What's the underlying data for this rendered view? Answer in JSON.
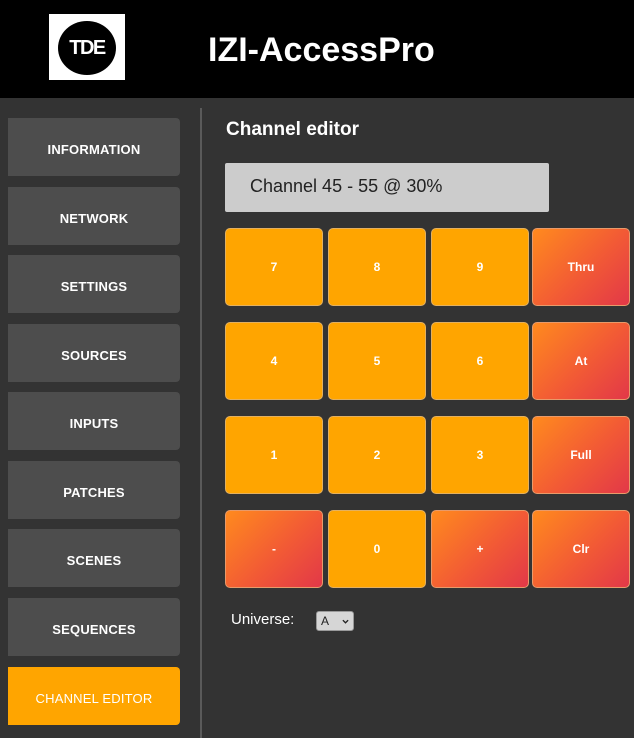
{
  "header": {
    "logo_text": "TDE",
    "app_title": "IZI-AccessPro"
  },
  "sidebar": {
    "items": [
      {
        "label": "INFORMATION"
      },
      {
        "label": "NETWORK"
      },
      {
        "label": "SETTINGS"
      },
      {
        "label": "SOURCES"
      },
      {
        "label": "INPUTS"
      },
      {
        "label": "PATCHES"
      },
      {
        "label": "SCENES"
      },
      {
        "label": "SEQUENCES"
      },
      {
        "label": "CHANNEL EDITOR",
        "active": true
      }
    ]
  },
  "editor": {
    "title": "Channel editor",
    "display": "Channel 45 - 55 @ 30%",
    "keypad": [
      [
        {
          "label": "7",
          "type": "digit"
        },
        {
          "label": "8",
          "type": "digit"
        },
        {
          "label": "9",
          "type": "digit"
        },
        {
          "label": "Thru",
          "type": "function"
        }
      ],
      [
        {
          "label": "4",
          "type": "digit"
        },
        {
          "label": "5",
          "type": "digit"
        },
        {
          "label": "6",
          "type": "digit"
        },
        {
          "label": "At",
          "type": "function"
        }
      ],
      [
        {
          "label": "1",
          "type": "digit"
        },
        {
          "label": "2",
          "type": "digit"
        },
        {
          "label": "3",
          "type": "digit"
        },
        {
          "label": "Full",
          "type": "function"
        }
      ],
      [
        {
          "label": "-",
          "type": "function"
        },
        {
          "label": "0",
          "type": "digit"
        },
        {
          "label": "+",
          "type": "function"
        },
        {
          "label": "Clr",
          "type": "function"
        }
      ]
    ],
    "universe_label": "Universe:",
    "universe_selected": "A"
  },
  "colors": {
    "accent": "#ffa500",
    "function_gradient_end": "#e23848",
    "sidebar_item": "#4d4d4d",
    "background": "#333333",
    "header": "#000000"
  },
  "icons": {
    "select_arrow": "chevron-down-icon"
  }
}
